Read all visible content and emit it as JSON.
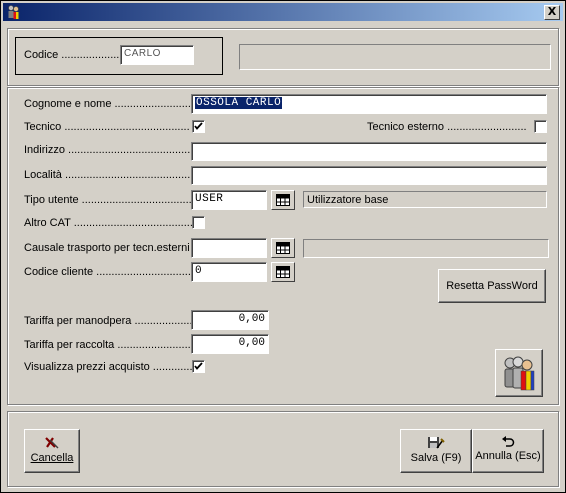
{
  "window": {
    "title": "",
    "close_glyph": "X",
    "title_icon": "users-icon"
  },
  "header": {
    "codice_label": "Codice ....................",
    "codice_value": "CARLO",
    "info_value": ""
  },
  "form": {
    "cognome_label": "Cognome e nome ..............................",
    "cognome_value": "OSSOLA CARLO",
    "tecnico_label": "Tecnico .........................................",
    "tecnico_checked": true,
    "tecnico_esterno_label": "Tecnico esterno ..........................",
    "tecnico_esterno_checked": false,
    "indirizzo_label": "Indirizzo ..........................................",
    "indirizzo_value": "",
    "localita_label": "Località ............................................",
    "localita_value": "",
    "tipo_utente_label": "Tipo utente ......................................",
    "tipo_utente_value": "USER",
    "tipo_utente_desc": "Utilizzatore base",
    "altro_cat_label": "Altro CAT ........................................",
    "altro_cat_checked": false,
    "causale_label": "Causale trasporto per tecn.esterni ....",
    "causale_value": "",
    "causale_desc": "",
    "codice_cliente_label": "Codice cliente ..................................",
    "codice_cliente_value": "0",
    "resetta_label": "Resetta PassWord",
    "tariffa_manodopera_label": "Tariffa per manodpera ......................",
    "tariffa_manodopera_value": "0,00",
    "tariffa_raccolta_label": "Tariffa per raccolta ...........................",
    "tariffa_raccolta_value": "0,00",
    "visualizza_label": "Visualizza prezzi acquisto .............",
    "visualizza_checked": true
  },
  "footer": {
    "cancella_label": "Cancella",
    "salva_label": "Salva (F9)",
    "annulla_label": "Annulla (Esc)"
  }
}
